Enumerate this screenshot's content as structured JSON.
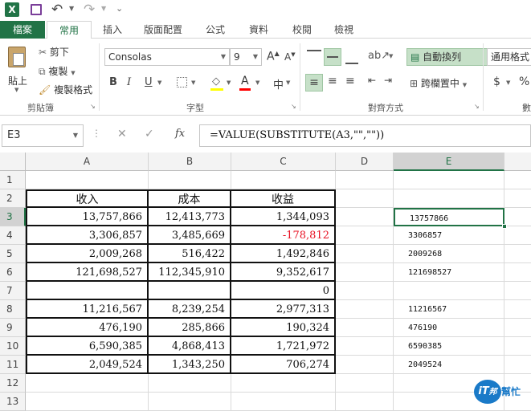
{
  "qat": {
    "undo": "↶",
    "redo": "↷"
  },
  "tabs": [
    "檔案",
    "常用",
    "插入",
    "版面配置",
    "公式",
    "資料",
    "校閱",
    "檢視"
  ],
  "clipboard": {
    "paste": "貼上",
    "cut": "剪下",
    "copy": "複製",
    "format_painter": "複製格式",
    "label": "剪貼簿"
  },
  "font": {
    "name": "Consolas",
    "size": "9",
    "bold": "B",
    "italic": "I",
    "underline": "U",
    "label": "字型",
    "grow": "A",
    "shrink": "A",
    "phonetic": "中"
  },
  "alignment": {
    "wrap": "自動換列",
    "merge": "跨欄置中",
    "label": "對齊方式"
  },
  "number": {
    "format": "通用格式",
    "currency": "$",
    "percent": "%",
    "label": "數"
  },
  "formula_bar": {
    "name_box": "E3",
    "fx": "fx",
    "formula": "=VALUE(SUBSTITUTE(A3,\"\",\"\"))"
  },
  "columns": [
    "A",
    "B",
    "C",
    "D",
    "E"
  ],
  "rows": [
    "1",
    "2",
    "3",
    "4",
    "5",
    "6",
    "7",
    "8",
    "9",
    "10",
    "11",
    "12",
    "13"
  ],
  "table": {
    "headers": [
      "收入",
      "成本",
      "收益"
    ],
    "data": [
      [
        "13,757,866",
        "12,413,773",
        "1,344,093"
      ],
      [
        "3,306,857",
        "3,485,669",
        "-178,812"
      ],
      [
        "2,009,268",
        "516,422",
        "1,492,846"
      ],
      [
        "121,698,527",
        "112,345,910",
        "9,352,617"
      ],
      [
        "",
        "",
        "0"
      ],
      [
        "11,216,567",
        "8,239,254",
        "2,977,313"
      ],
      [
        "476,190",
        "285,866",
        "190,324"
      ],
      [
        "6,590,385",
        "4,868,413",
        "1,721,972"
      ],
      [
        "2,049,524",
        "1,343,250",
        "706,274"
      ]
    ]
  },
  "colE": [
    "13757866",
    "3306857",
    "2009268",
    "121698527",
    "",
    "11216567",
    "476190",
    "6590385",
    "2049524"
  ],
  "watermark": {
    "main": "iT",
    "sub": "邦",
    "tag": "幫忙"
  },
  "colors": {
    "excel_green": "#217346",
    "negative": "#e81123",
    "selection": "#217346"
  }
}
